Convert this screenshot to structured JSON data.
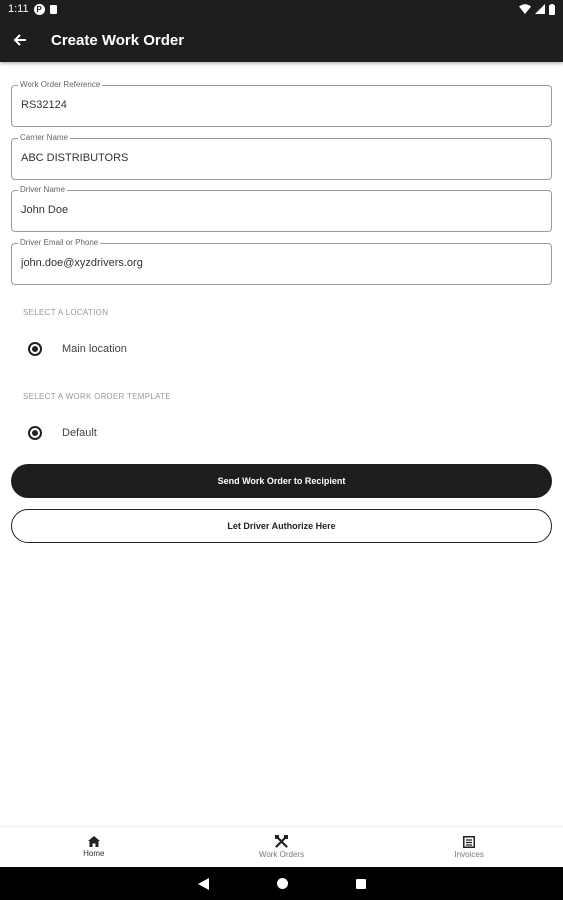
{
  "status_bar": {
    "time": "1:11",
    "p_icon": "P"
  },
  "app_bar": {
    "title": "Create Work Order"
  },
  "form": {
    "work_order_reference": {
      "label": "Work Order Reference",
      "value": "RS32124"
    },
    "carrier_name": {
      "label": "Carrier Name",
      "value": "ABC DISTRIBUTORS"
    },
    "driver_name": {
      "label": "Driver Name",
      "value": "John Doe"
    },
    "driver_contact": {
      "label": "Driver Email or Phone",
      "value": "john.doe@xyzdrivers.org"
    }
  },
  "location": {
    "heading": "SELECT A LOCATION",
    "option": "Main location"
  },
  "template": {
    "heading": "SELECT A WORK ORDER TEMPLATE",
    "option": "Default"
  },
  "actions": {
    "send_label": "Send Work Order to Recipient",
    "authorize_label": "Let Driver Authorize Here"
  },
  "bottom_nav": {
    "items": [
      {
        "label": "Home",
        "icon": "home-icon"
      },
      {
        "label": "Work Orders",
        "icon": "tools-icon"
      },
      {
        "label": "Invoices",
        "icon": "invoice-icon"
      }
    ]
  },
  "colors": {
    "bar": "#1e1e1e",
    "accent": "#222222"
  }
}
